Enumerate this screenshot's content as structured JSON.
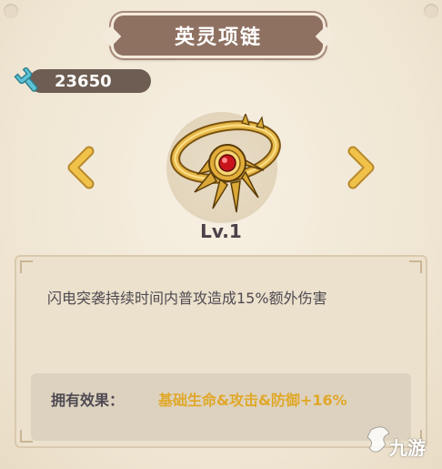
{
  "title": "英灵项链",
  "currency": {
    "icon": "wrench-icon",
    "value": "23650"
  },
  "item": {
    "icon": "necklace-icon",
    "level": "Lv.1"
  },
  "navigation": {
    "prev_icon": "chevron-left-icon",
    "next_icon": "chevron-right-icon"
  },
  "description": "闪电突袭持续时间内普攻造成15%额外伤害",
  "effect": {
    "label": "拥有效果：",
    "value": "基础生命&攻击&防御+16%"
  },
  "watermark": {
    "text": "九游"
  },
  "colors": {
    "background": "#f2eadb",
    "banner": "#8f7162",
    "currency_pill": "#6d5d52",
    "arrow": "#e8b840",
    "effect_value": "#e0a82a",
    "text": "#4e4a52"
  }
}
